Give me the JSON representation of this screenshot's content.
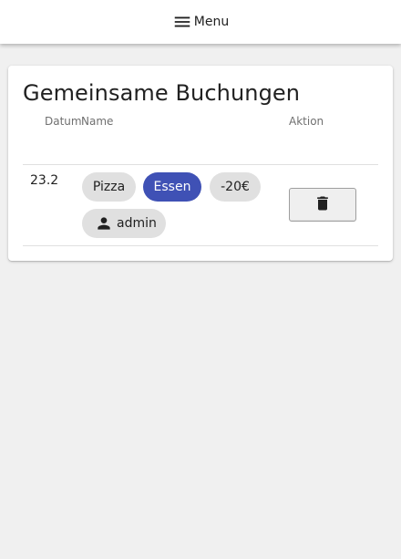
{
  "topbar": {
    "menu_label": "Menu",
    "menu_icon": "hamburger-menu-icon"
  },
  "card": {
    "title": "Gemeinsame Buchungen",
    "columns": {
      "date": "Datum",
      "name": "Name",
      "action": "Aktion"
    },
    "rows": [
      {
        "date": "23.2",
        "tags": [
          "Pizza",
          "Essen",
          "-20€"
        ],
        "user": "admin",
        "user_icon": "person-icon",
        "delete_icon": "trash-icon"
      }
    ]
  },
  "colors": {
    "accent": "#3f51b5",
    "chip": "#e0e0e0",
    "background": "#f0f0f0"
  }
}
